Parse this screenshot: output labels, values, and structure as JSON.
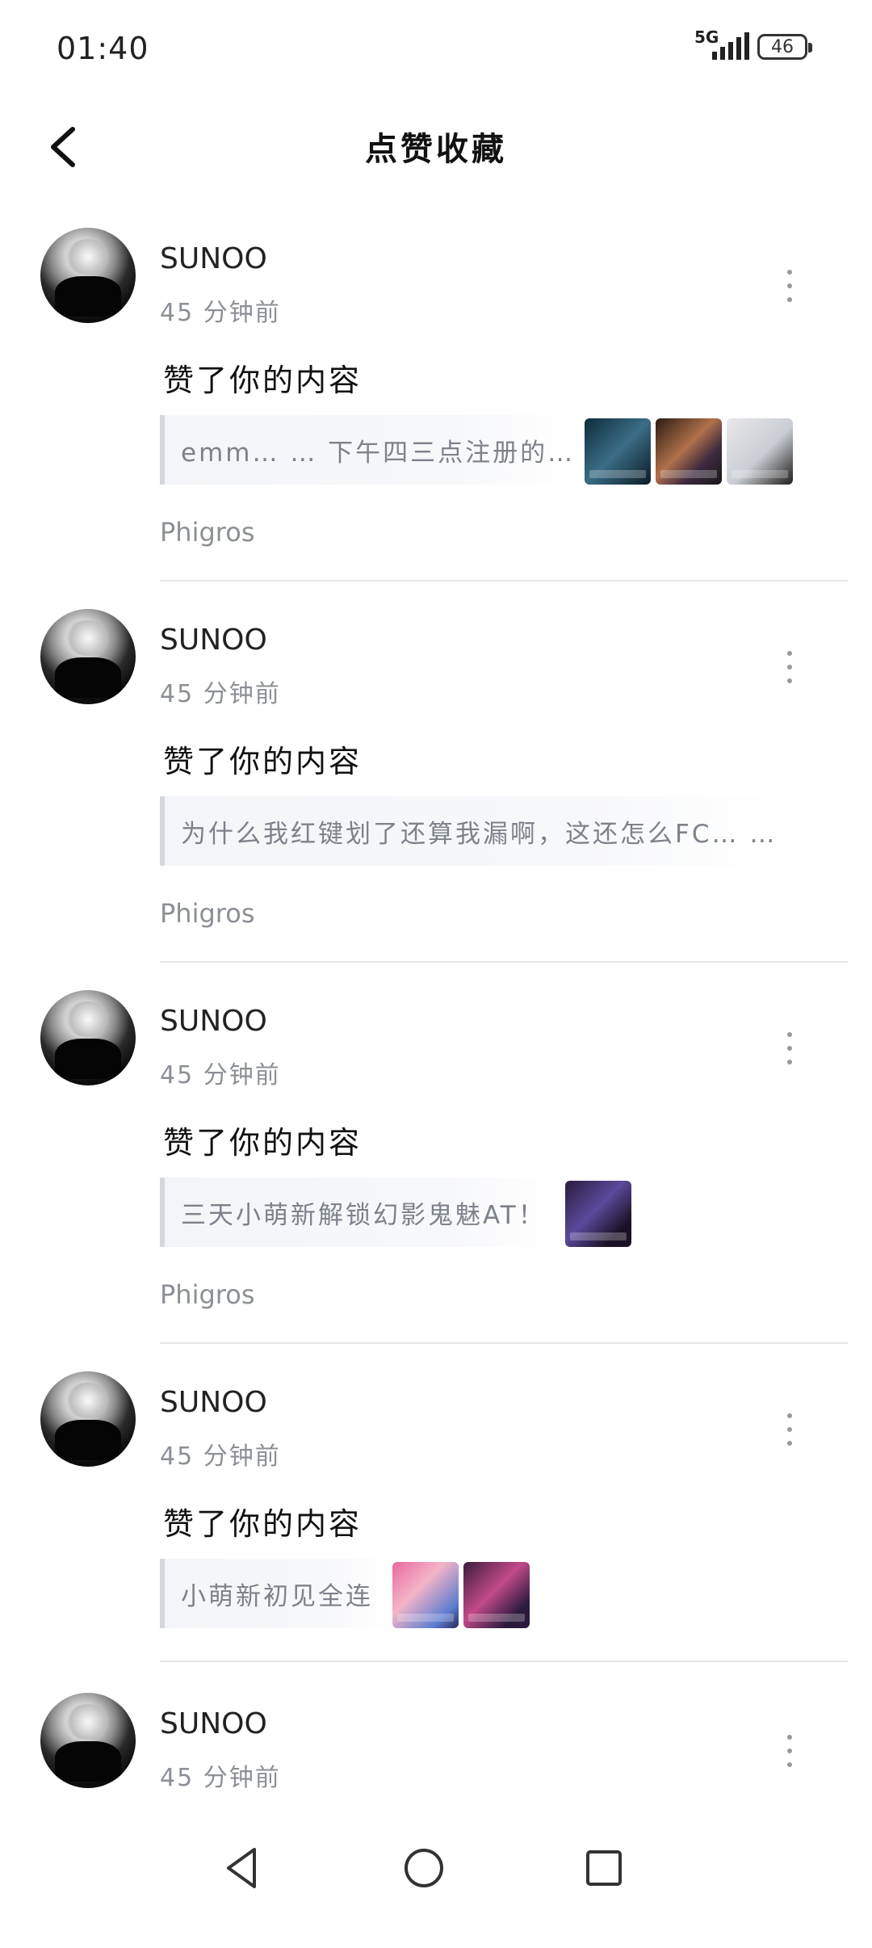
{
  "status": {
    "time": "01:40",
    "network": "5G",
    "battery": "46"
  },
  "header": {
    "title": "点赞收藏"
  },
  "items": [
    {
      "user": "SUNOO",
      "time": "45 分钟前",
      "action": "赞了你的内容",
      "quote": "emm… … 下午四三点注册的…",
      "tag": "Phigros"
    },
    {
      "user": "SUNOO",
      "time": "45 分钟前",
      "action": "赞了你的内容",
      "quote": "为什么我红键划了还算我漏啊，这还怎么FC… …",
      "tag": "Phigros"
    },
    {
      "user": "SUNOO",
      "time": "45 分钟前",
      "action": "赞了你的内容",
      "quote": "三天小萌新解锁幻影鬼魅AT！",
      "tag": "Phigros"
    },
    {
      "user": "SUNOO",
      "time": "45 分钟前",
      "action": "赞了你的内容",
      "quote": "小萌新初见全连"
    },
    {
      "user": "SUNOO",
      "time": "45 分钟前"
    }
  ]
}
